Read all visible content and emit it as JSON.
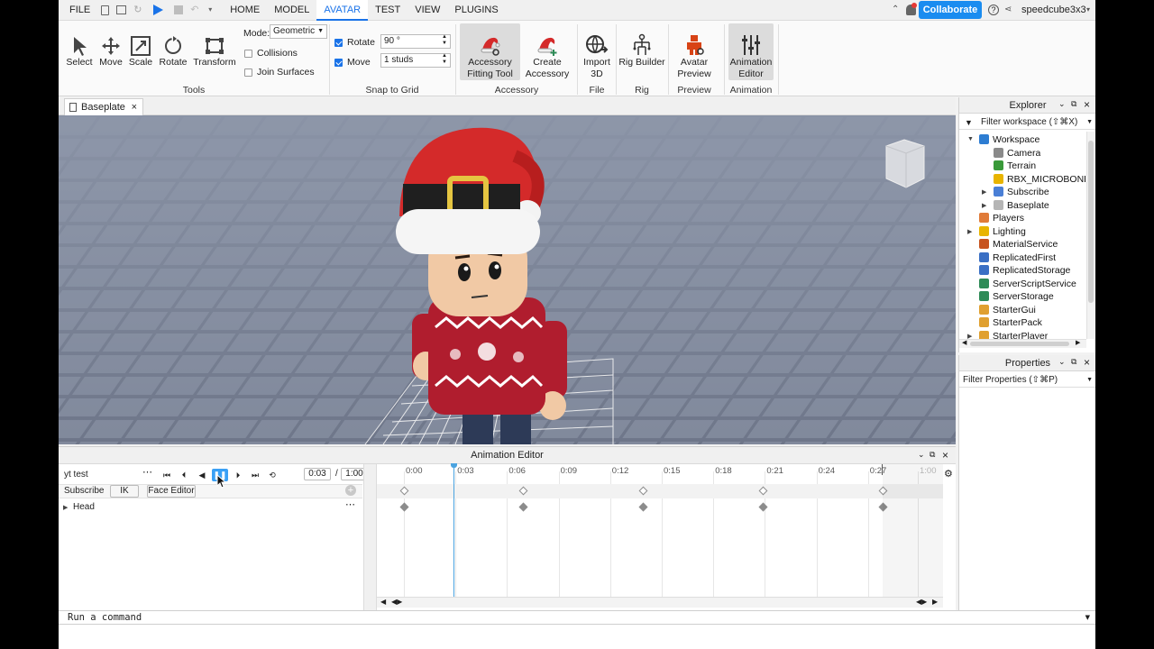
{
  "menubar": {
    "file": "FILE",
    "tabs": [
      "HOME",
      "MODEL",
      "AVATAR",
      "TEST",
      "VIEW",
      "PLUGINS"
    ],
    "active_tab": "AVATAR",
    "collaborate": "Collaborate",
    "username": "speedcube3x3"
  },
  "ribbon": {
    "tools": {
      "select": "Select",
      "move": "Move",
      "scale": "Scale",
      "rotate": "Rotate",
      "transform": "Transform",
      "group": "Tools"
    },
    "mode_label": "Mode:",
    "mode_value": "Geometric",
    "collisions": "Collisions",
    "join_surfaces": "Join Surfaces",
    "snap": {
      "rotate_label": "Rotate",
      "rotate_value": "90 °",
      "move_label": "Move",
      "move_value": "1 studs",
      "group": "Snap to Grid"
    },
    "accessory": {
      "fitting_tool_line1": "Accessory",
      "fitting_tool_line2": "Fitting Tool",
      "create_line1": "Create",
      "create_line2": "Accessory",
      "group": "Accessory"
    },
    "file": {
      "import_line1": "Import",
      "import_line2": "3D",
      "group": "File"
    },
    "rig": {
      "rig_builder": "Rig Builder",
      "group": "Rig"
    },
    "preview": {
      "avatar_line1": "Avatar",
      "avatar_line2": "Preview",
      "group": "Preview"
    },
    "animation": {
      "editor_line1": "Animation",
      "editor_line2": "Editor",
      "group": "Animation"
    }
  },
  "doc_tab": "Baseplate",
  "animation_editor": {
    "title": "Animation Editor",
    "animation_name": "yt test",
    "current_time": "0:03",
    "time_separator": "/",
    "end_time": "1:00",
    "track_header": "Subscribe",
    "ik_button": "IK",
    "face_editor_button": "Face Editor",
    "track": "Head",
    "timeline_ticks": [
      "0:00",
      "0:03",
      "0:06",
      "0:09",
      "0:12",
      "0:15",
      "0:18",
      "0:21",
      "0:24",
      "0:27",
      "1:00"
    ]
  },
  "explorer": {
    "title": "Explorer",
    "filter_placeholder": "Filter workspace (⇧⌘X)",
    "items": [
      {
        "label": "Workspace",
        "color": "#2d7dd2"
      },
      {
        "label": "Camera",
        "color": "#8a8a8a"
      },
      {
        "label": "Terrain",
        "color": "#3a9a3a"
      },
      {
        "label": "RBX_MICROBONE_N",
        "color": "#e8b400"
      },
      {
        "label": "Subscribe",
        "color": "#4a7fd6"
      },
      {
        "label": "Baseplate",
        "color": "#b5b5b5"
      },
      {
        "label": "Players",
        "color": "#e07b39"
      },
      {
        "label": "Lighting",
        "color": "#e8b400"
      },
      {
        "label": "MaterialService",
        "color": "#c7531f"
      },
      {
        "label": "ReplicatedFirst",
        "color": "#3a6fc4"
      },
      {
        "label": "ReplicatedStorage",
        "color": "#3a6fc4"
      },
      {
        "label": "ServerScriptService",
        "color": "#2e8b57"
      },
      {
        "label": "ServerStorage",
        "color": "#2e8b57"
      },
      {
        "label": "StarterGui",
        "color": "#e0a030"
      },
      {
        "label": "StarterPack",
        "color": "#e0a030"
      },
      {
        "label": "StarterPlayer",
        "color": "#e0a030"
      }
    ]
  },
  "properties": {
    "title": "Properties",
    "filter_placeholder": "Filter Properties (⇧⌘P)"
  },
  "command_bar": {
    "placeholder": "Run a command"
  },
  "colors": {
    "accent": "#1a73e8",
    "collaborate_button": "#1a8cf0",
    "viewport_floor": "#8d96a8",
    "hat_red": "#d42a2a",
    "sweater_red": "#b01d2e"
  }
}
